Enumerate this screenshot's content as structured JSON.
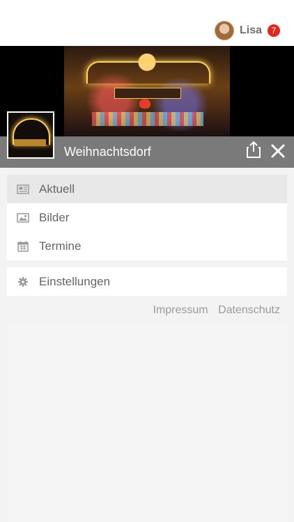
{
  "user": {
    "name": "Lisa",
    "notification_count": "7"
  },
  "profile": {
    "title": "Weihnachtsdorf"
  },
  "menu": {
    "items": [
      {
        "label": "Aktuell",
        "icon": "newspaper-icon",
        "active": true
      },
      {
        "label": "Bilder",
        "icon": "image-icon",
        "active": false
      },
      {
        "label": "Termine",
        "icon": "calendar-icon",
        "active": false
      }
    ],
    "settings": {
      "label": "Einstellungen",
      "icon": "gear-icon"
    }
  },
  "footer": {
    "impressum": "Impressum",
    "datenschutz": "Datenschutz"
  },
  "colors": {
    "accent_badge": "#e2281c",
    "title_bar": "#7a7a7a"
  }
}
